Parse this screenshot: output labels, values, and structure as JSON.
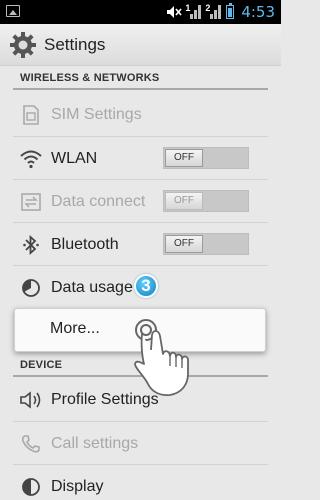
{
  "status_bar": {
    "time": "4:53",
    "sim1_number": "1",
    "sim2_number": "2",
    "icons": [
      "image-notification-icon",
      "mute-icon",
      "signal-sim1-icon",
      "signal-sim2-icon",
      "battery-icon"
    ]
  },
  "action_bar": {
    "title": "Settings",
    "icon": "settings-gear-icon"
  },
  "sections": {
    "wireless": "WIRELESS & NETWORKS",
    "device": "DEVICE"
  },
  "rows": {
    "sim_settings": {
      "label": "SIM Settings",
      "icon": "sim-card-icon",
      "enabled": false
    },
    "wlan": {
      "label": "WLAN",
      "icon": "wifi-icon",
      "toggle": "OFF"
    },
    "data_connect": {
      "label": "Data connect",
      "icon": "data-transfer-icon",
      "toggle": "OFF",
      "enabled": false
    },
    "bluetooth": {
      "label": "Bluetooth",
      "icon": "bluetooth-icon",
      "toggle": "OFF"
    },
    "data_usage": {
      "label": "Data usage",
      "icon": "data-usage-icon"
    },
    "more": {
      "label": "More..."
    },
    "profile_settings": {
      "label": "Profile Settings",
      "icon": "speaker-icon"
    },
    "call_settings": {
      "label": "Call settings",
      "icon": "phone-icon",
      "enabled": false
    },
    "display": {
      "label": "Display",
      "icon": "display-icon"
    }
  },
  "overlay": {
    "step_number": "3",
    "hand_icon": "tap-hand-icon"
  },
  "colors": {
    "accent": "#5fb8e8",
    "badge": "#1e90d0",
    "disabled_text": "#a8a8a8"
  }
}
